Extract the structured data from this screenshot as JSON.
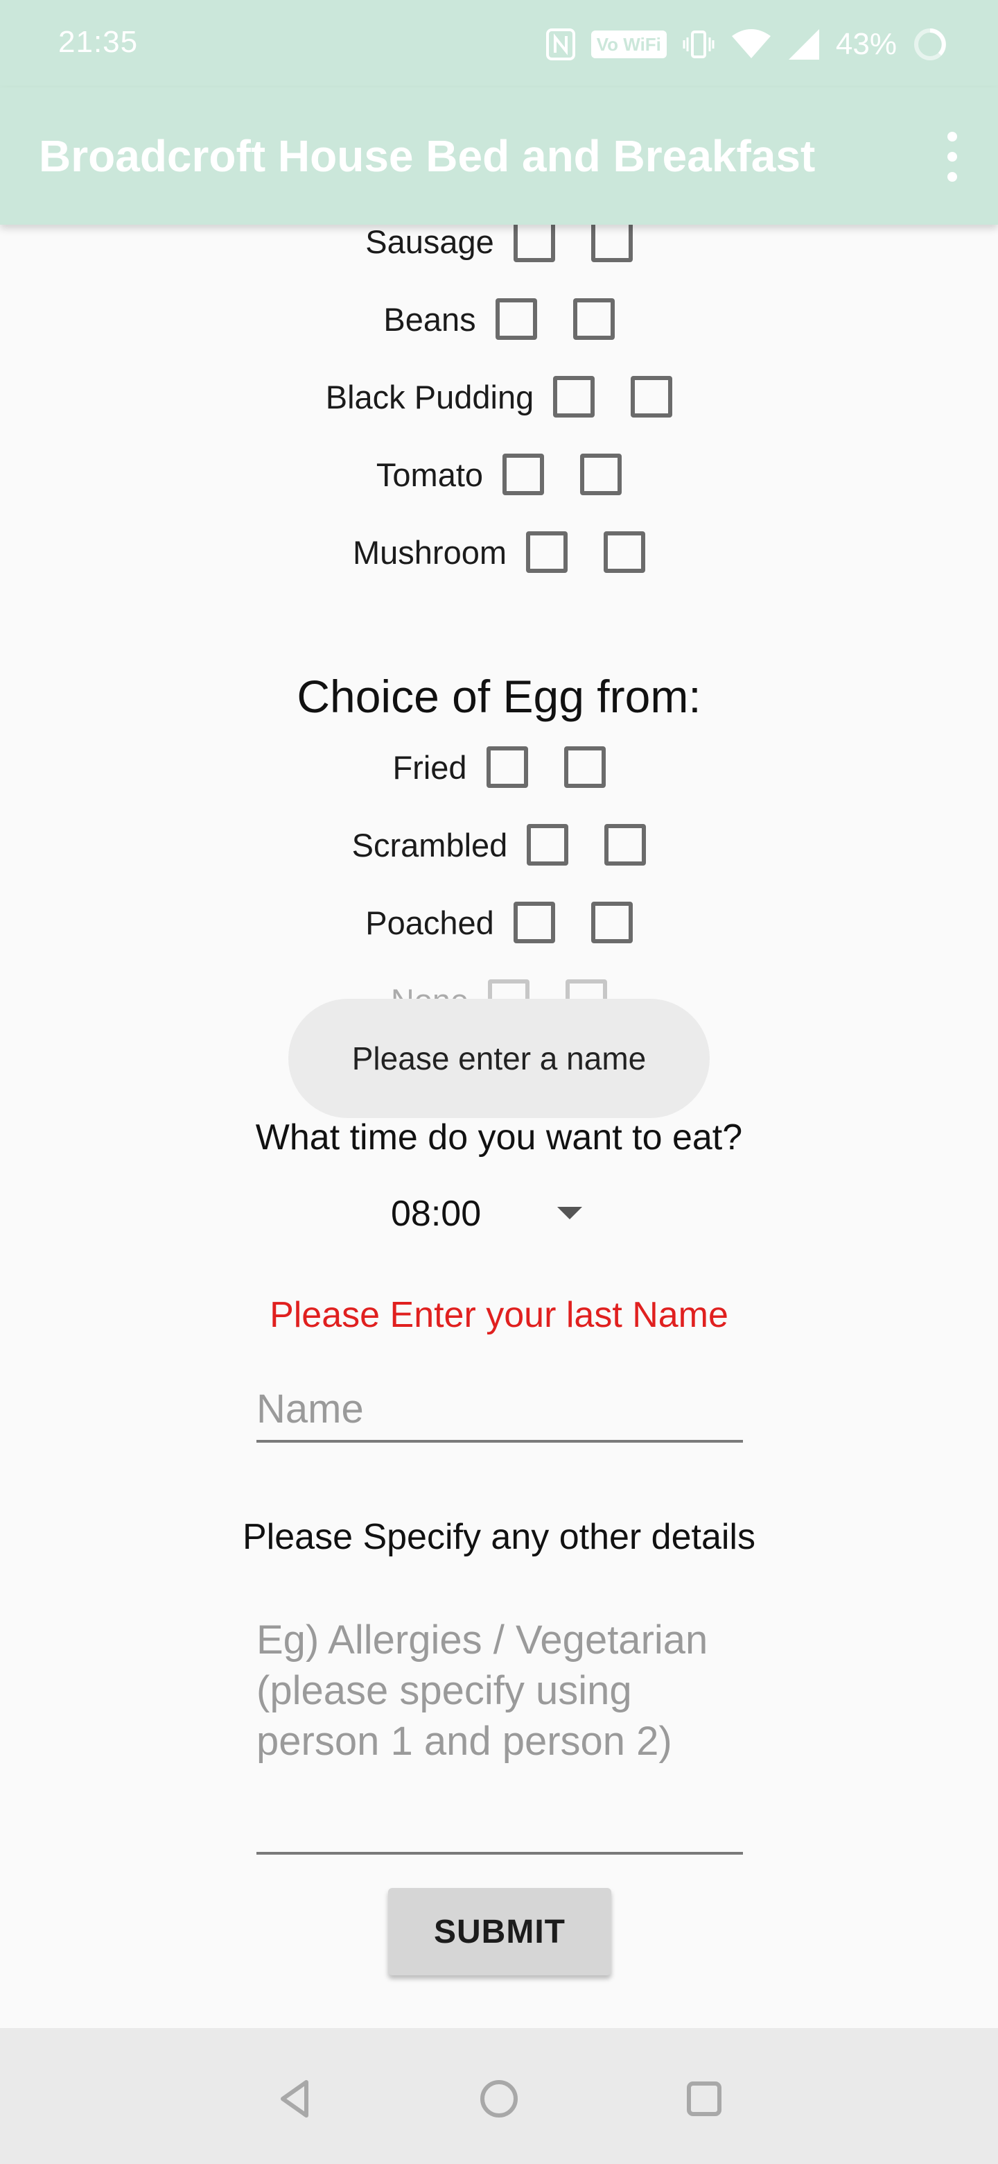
{
  "status_bar": {
    "time": "21:35",
    "nfc_icon": "nfc-icon",
    "wifi_calling_label": "Vo WiFi",
    "vibrate_icon": "vibrate-icon",
    "wifi_icon": "wifi-icon",
    "signal_icon": "signal-icon",
    "battery": "43%",
    "battery_icon": "battery-charging-icon"
  },
  "app_bar": {
    "title": "Broadcroft House Bed and Breakfast",
    "menu_icon": "more-vert-icon",
    "color": "#cbe7da"
  },
  "breakfast_items": [
    {
      "label": "Sausage"
    },
    {
      "label": "Beans"
    },
    {
      "label": "Black Pudding"
    },
    {
      "label": "Tomato"
    },
    {
      "label": "Mushroom"
    }
  ],
  "egg_section": {
    "heading": "Choice of Egg from:",
    "options": [
      {
        "label": "Fried"
      },
      {
        "label": "Scrambled"
      },
      {
        "label": "Poached"
      },
      {
        "label": "None"
      }
    ]
  },
  "toast": {
    "message": "Please enter a name"
  },
  "time_section": {
    "question": "What time do you want to eat?",
    "selected_time": "08:00",
    "dropdown_icon": "dropdown-arrow-icon"
  },
  "name_section": {
    "error": "Please Enter your last Name",
    "error_color": "#e0201f",
    "placeholder": "Name"
  },
  "details_section": {
    "label": "Please Specify any other details",
    "placeholder": "Eg) Allergies / Vegetarian (please specify using person 1 and person 2)"
  },
  "submit": {
    "label": "SUBMIT"
  },
  "nav_bar": {
    "back_icon": "back-triangle-icon",
    "home_icon": "home-circle-icon",
    "recents_icon": "recents-square-icon"
  }
}
